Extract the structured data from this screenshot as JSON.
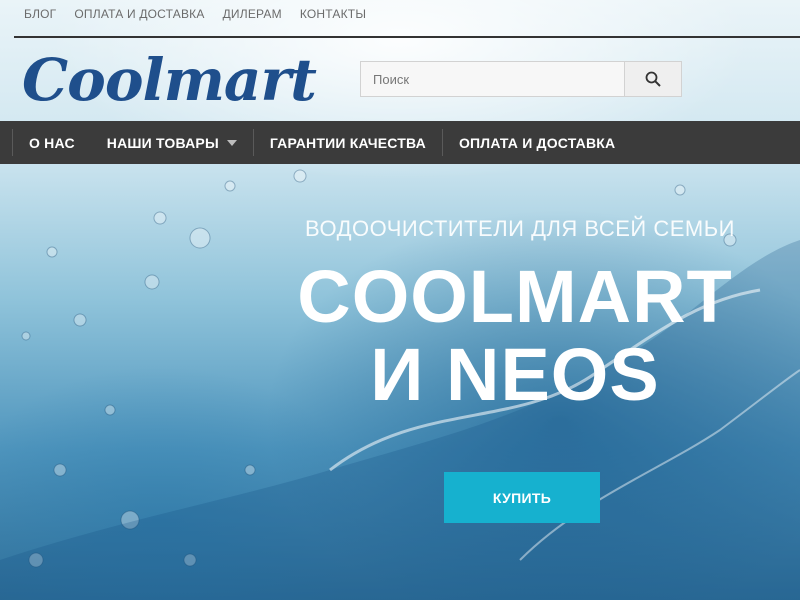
{
  "top_links": [
    "БЛОГ",
    "ОПЛАТА И ДОСТАВКА",
    "ДИЛЕРАМ",
    "КОНТАКТЫ"
  ],
  "header": {
    "logo_text": "Coolmart",
    "search_placeholder": "Поиск",
    "search_icon": "search-icon"
  },
  "nav": {
    "items": [
      {
        "label": "О НАС",
        "has_dropdown": false
      },
      {
        "label": "НАШИ ТОВАРЫ",
        "has_dropdown": true
      },
      {
        "label": "ГАРАНТИИ КАЧЕСТВА",
        "has_dropdown": false
      },
      {
        "label": "ОПЛАТА И ДОСТАВКА",
        "has_dropdown": false
      }
    ]
  },
  "hero": {
    "subtitle": "ВОДООЧИСТИТЕЛИ ДЛЯ ВСЕЙ СЕМЬИ",
    "headline_line1": "COOLMART",
    "headline_line2": "И NEOS",
    "button_label": "КУПИТЬ"
  },
  "colors": {
    "nav_bg": "#3b3b3b",
    "logo": "#1f4f8c",
    "accent_button": "#16b1cf"
  }
}
